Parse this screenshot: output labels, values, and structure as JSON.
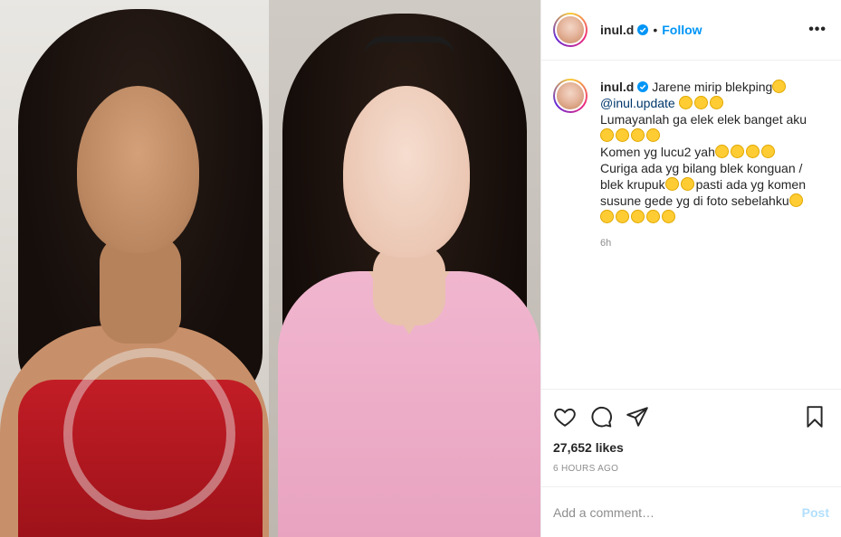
{
  "header": {
    "username": "inul.d",
    "separator": "•",
    "follow_label": "Follow",
    "more_label": "•••",
    "verified_color": "#0095f6"
  },
  "caption": {
    "username": "inul.d",
    "line1": "Jarene mirip blekping",
    "mention": "@inul.update",
    "line2": "Lumayanlah ga elek elek banget aku",
    "line3": "Komen yg lucu2 yah",
    "line4": "Curiga ada yg bilang blek konguan / blek krupuk",
    "line5": "pasti ada yg komen susune gede yg di foto sebelahku",
    "time": "6h"
  },
  "actions": {
    "icons": [
      "heart-icon",
      "comment-icon",
      "share-icon",
      "bookmark-icon"
    ],
    "likes": "27,652 likes",
    "posted": "6 HOURS AGO"
  },
  "comment_box": {
    "placeholder": "Add a comment…",
    "post_label": "Post"
  },
  "colors": {
    "accent": "#0095f6",
    "post_disabled": "#b2dffc",
    "muted": "#8e8e8e"
  }
}
